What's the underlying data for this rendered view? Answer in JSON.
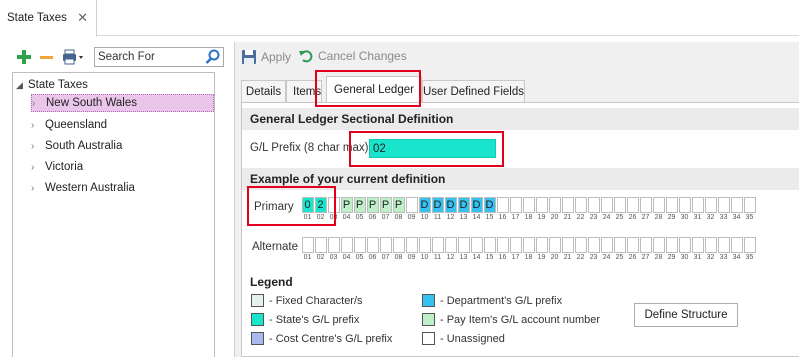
{
  "doc_tab": {
    "title": "State Taxes",
    "close": "✕"
  },
  "left_toolbar": {
    "search_placeholder": "Search For"
  },
  "tree": {
    "root": "State Taxes",
    "children": [
      {
        "label": "New South Wales",
        "selected": true
      },
      {
        "label": "Queensland",
        "selected": false
      },
      {
        "label": "South Australia",
        "selected": false
      },
      {
        "label": "Victoria",
        "selected": false
      },
      {
        "label": "Western Australia",
        "selected": false
      }
    ]
  },
  "actions": {
    "apply": "Apply",
    "cancel": "Cancel Changes"
  },
  "tabs": [
    "Details",
    "Items",
    "General Ledger",
    "User Defined Fields"
  ],
  "active_tab": "General Ledger",
  "gl_section": {
    "heading": "General Ledger Sectional Definition",
    "prefix_label": "G/L Prefix (8 char max)",
    "prefix_value": "02"
  },
  "example_section": {
    "heading": "Example of your current definition",
    "primary_label": "Primary",
    "alternate_label": "Alternate",
    "primary_cells": [
      "0",
      "2",
      "",
      "P",
      "P",
      "P",
      "P",
      "P",
      "",
      "D",
      "D",
      "D",
      "D",
      "D",
      "D",
      "",
      "",
      "",
      "",
      "",
      "",
      "",
      "",
      "",
      "",
      "",
      "",
      "",
      "",
      "",
      "",
      "",
      "",
      "",
      ""
    ],
    "primary_types": [
      "state",
      "state",
      "empty",
      "pay",
      "pay",
      "pay",
      "pay",
      "pay",
      "empty",
      "dept",
      "dept",
      "dept",
      "dept",
      "dept",
      "dept",
      "empty",
      "empty",
      "empty",
      "empty",
      "empty",
      "empty",
      "empty",
      "empty",
      "empty",
      "empty",
      "empty",
      "empty",
      "empty",
      "empty",
      "empty",
      "empty",
      "empty",
      "empty",
      "empty",
      "empty"
    ],
    "numbers": [
      "01",
      "02",
      "03",
      "04",
      "05",
      "06",
      "07",
      "08",
      "09",
      "10",
      "11",
      "12",
      "13",
      "14",
      "15",
      "16",
      "17",
      "18",
      "19",
      "20",
      "21",
      "22",
      "23",
      "24",
      "25",
      "26",
      "27",
      "28",
      "29",
      "30",
      "31",
      "32",
      "33",
      "34",
      "35"
    ]
  },
  "legend": {
    "title": "Legend",
    "items": [
      {
        "label": "- Fixed Character/s",
        "color": "#e4f1ef"
      },
      {
        "label": "- State's G/L prefix",
        "color": "#19e5cd"
      },
      {
        "label": "- Cost Centre's G/L prefix",
        "color": "#a9b9ec"
      },
      {
        "label": "- Department's G/L prefix",
        "color": "#36c2f0"
      },
      {
        "label": "- Pay Item's G/L account number",
        "color": "#bdf0c9"
      },
      {
        "label": "- Unassigned",
        "color": "#ffffff"
      }
    ]
  },
  "define_button": "Define Structure",
  "colors": {
    "state": "#19e5cd",
    "dept": "#36c2f0",
    "pay": "#bdf0c9",
    "empty": "#ffffff",
    "highlight": "#e0001b",
    "selected_row": "#e9c6ea"
  }
}
